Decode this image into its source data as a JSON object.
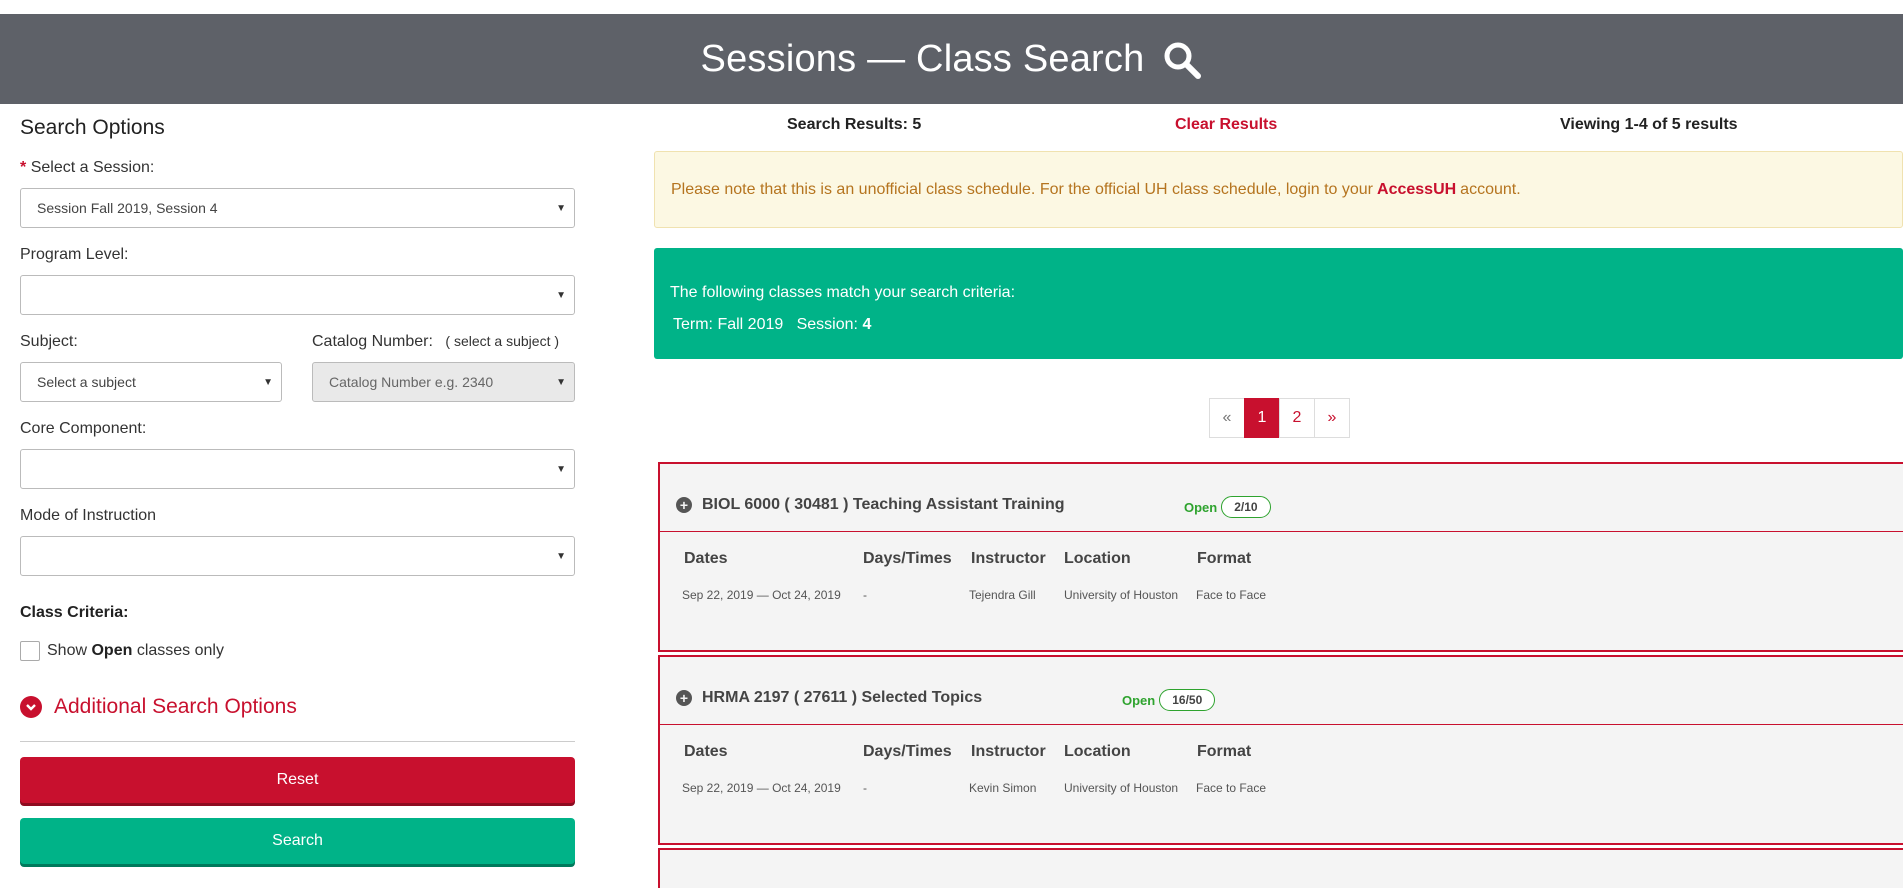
{
  "header": {
    "title": "Sessions — Class Search",
    "icon": "search-icon"
  },
  "left": {
    "title": "Search Options",
    "session": {
      "label": "Select a Session:",
      "required": "*",
      "value": "Session Fall 2019, Session 4"
    },
    "program_level": {
      "label": "Program Level:",
      "value": ""
    },
    "subject": {
      "label": "Subject:",
      "value": "Select a subject"
    },
    "catalog": {
      "label": "Catalog Number:",
      "note": "( select a subject )",
      "placeholder": "Catalog Number e.g. 2340"
    },
    "core": {
      "label": "Core Component:",
      "value": ""
    },
    "mode": {
      "label": "Mode of Instruction",
      "value": ""
    },
    "criteria_label": "Class Criteria:",
    "open_only": {
      "pre": "Show",
      "bold": "Open",
      "post": "classes only"
    },
    "additional": "Additional Search Options",
    "reset_label": "Reset",
    "search_label": "Search"
  },
  "results": {
    "count_text": "Search Results: 5",
    "clear_text": "Clear Results",
    "viewing_text": "Viewing 1-4 of 5 results",
    "note": {
      "pre": "Please note that this is an unofficial class schedule. For the official UH class schedule, login to your",
      "link": "AccessUH",
      "post": "account."
    },
    "criteria": {
      "line1": "The following classes match your search criteria:",
      "term": "Term: Fall 2019",
      "session_label": "Session:",
      "session_value": "4"
    },
    "pager": [
      "«",
      "1",
      "2",
      "»"
    ],
    "columns": [
      "Dates",
      "Days/Times",
      "Instructor",
      "Location",
      "Format"
    ],
    "classes": [
      {
        "title": "BIOL 6000 ( 30481 ) Teaching Assistant Training",
        "status": "Open",
        "seats": "2/10",
        "dates": "Sep 22, 2019 — Oct 24, 2019",
        "days": "-",
        "instructor": "Tejendra Gill",
        "location": "University of Houston",
        "format": "Face to Face"
      },
      {
        "title": "HRMA 2197 ( 27611 ) Selected Topics",
        "status": "Open",
        "seats": "16/50",
        "dates": "Sep 22, 2019 — Oct 24, 2019",
        "days": "-",
        "instructor": "Kevin Simon",
        "location": "University of Houston",
        "format": "Face to Face"
      }
    ],
    "colors": {
      "brand_red": "#c8102e",
      "brand_green": "#00b388",
      "header_gray": "#5e6168",
      "open_green": "#2ea32e"
    }
  }
}
